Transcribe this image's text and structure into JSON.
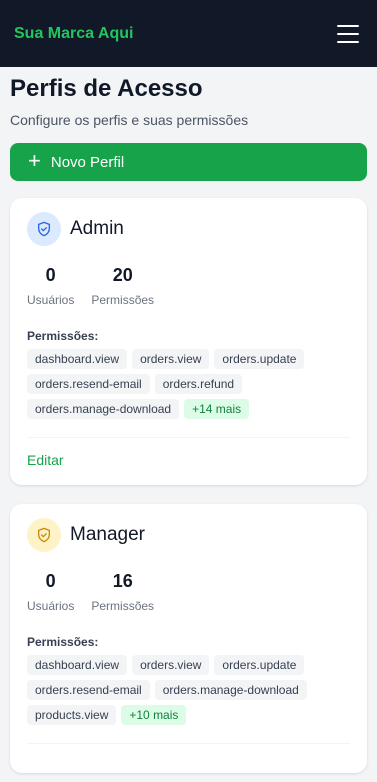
{
  "header": {
    "brand": "Sua Marca Aqui",
    "menu_icon": "hamburger-icon"
  },
  "page": {
    "title": "Perfis de Acesso",
    "subtitle": "Configure os perfis e suas permissões",
    "new_button": "Novo Perfil"
  },
  "roles": [
    {
      "name": "Admin",
      "icon_color": "#2563eb",
      "users": "0",
      "users_label": "Usuários",
      "permissions": "20",
      "permissions_label": "Permissões",
      "perm_title": "Permissões:",
      "tags": [
        "dashboard.view",
        "orders.view",
        "orders.update",
        "orders.resend-email",
        "orders.refund",
        "orders.manage-download"
      ],
      "more": "+14 mais",
      "edit": "Editar"
    },
    {
      "name": "Manager",
      "icon_color": "#ca8a04",
      "users": "0",
      "users_label": "Usuários",
      "permissions": "16",
      "permissions_label": "Permissões",
      "perm_title": "Permissões:",
      "tags": [
        "dashboard.view",
        "orders.view",
        "orders.update",
        "orders.resend-email",
        "orders.manage-download",
        "products.view"
      ],
      "more": "+10 mais"
    }
  ]
}
